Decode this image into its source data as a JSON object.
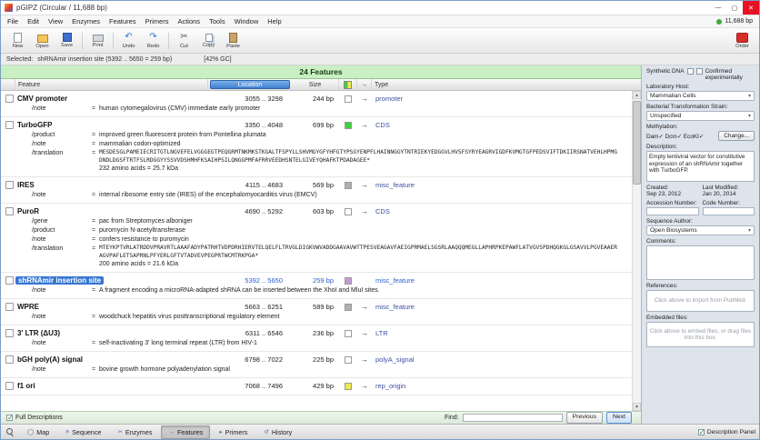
{
  "window": {
    "title": "pGIPZ  (Circular / 11,688 bp)",
    "bp_indicator": "11,688 bp"
  },
  "menu": {
    "items": [
      "File",
      "Edit",
      "View",
      "Enzymes",
      "Features",
      "Primers",
      "Actions",
      "Tools",
      "Window",
      "Help"
    ]
  },
  "toolbar": {
    "buttons": [
      {
        "label": "New",
        "icon": "new-document-icon"
      },
      {
        "label": "Open",
        "icon": "open-folder-icon"
      },
      {
        "label": "Save",
        "icon": "save-disk-icon"
      },
      {
        "label": "Print",
        "icon": "printer-icon"
      },
      {
        "label": "Undo",
        "icon": "undo-arrow-icon"
      },
      {
        "label": "Redo",
        "icon": "redo-arrow-icon"
      },
      {
        "label": "Cut",
        "icon": "cut-icon"
      },
      {
        "label": "Copy",
        "icon": "copy-icon"
      },
      {
        "label": "Paste",
        "icon": "paste-icon"
      }
    ],
    "order": {
      "label": "Order",
      "icon": "order-cart-icon"
    }
  },
  "selection_bar": {
    "label": "Selected:",
    "text": "shRNAmir insertion site  (5392 .. 5650 = 259 bp)",
    "gc": "[42% GC]"
  },
  "features_panel": {
    "header": "24 Features",
    "columns": {
      "feature": "Feature",
      "location": "Location",
      "size": "Size",
      "type": "Type"
    },
    "features": [
      {
        "name": "CMV promoter",
        "location": "3055 .. 3298",
        "size": "244 bp",
        "color": "#ffffff",
        "arrow": "→",
        "type": "promoter",
        "selected": false,
        "qualifiers": [
          {
            "key": "/note",
            "value": "human cytomegalovirus (CMV) immediate early promoter"
          }
        ]
      },
      {
        "name": "TurboGFP",
        "location": "3350 .. 4048",
        "size": "699 bp",
        "color": "#3ecf3e",
        "arrow": "→",
        "type": "CDS",
        "selected": false,
        "qualifiers": [
          {
            "key": "/product",
            "value": "improved green fluorescent protein from Pontellina plumata"
          },
          {
            "key": "/note",
            "value": "mammalian codon-optimized"
          },
          {
            "key": "/translation",
            "value": "MESDESGLPAMEIECRITGTLNGVEFELVGGGEGTPEQGRMTNKMKSTKGALTFSPYLLSHVMGYGFYHFGTYPSGYENPFLHAINNGGYTNTRIEKYEDGGVLHVSFSYRYEAGRVIGDFKVMGTGFPEDSVIFTDKIIRSNATVEHLHPMGDNDLDGSFTRTFSLRDGGYYSSVVDSHMHFKSAIHPSILQNGGPMFAFRRVEEDHSNTELGIVEYQHAFKTPDADAGEE*"
          }
        ],
        "footnote": "232 amino acids  =  25.7 kDa"
      },
      {
        "name": "IRES",
        "location": "4115 .. 4683",
        "size": "569 bp",
        "color": "#b0b0b0",
        "arrow": "→",
        "type": "misc_feature",
        "selected": false,
        "qualifiers": [
          {
            "key": "/note",
            "value": "internal ribosome entry site (IRES) of the encephalomyocarditis virus (EMCV)"
          }
        ]
      },
      {
        "name": "PuroR",
        "location": "4690 .. 5292",
        "size": "603 bp",
        "color": "#ffffff",
        "arrow": "→",
        "type": "CDS",
        "selected": false,
        "qualifiers": [
          {
            "key": "/gene",
            "value": "pac from Streptomyces alboniger"
          },
          {
            "key": "/product",
            "value": "puromycin N-acetyltransferase"
          },
          {
            "key": "/note",
            "value": "confers resistance to puromycin"
          },
          {
            "key": "/translation",
            "value": "MTEYKPTVRLATRDDVPRAVRTLAAAFADYPATRHTVDPDRHIERVTELQELFLTRVGLDIGKVWVADDGAAVAVWTTPESVEAGAVFAEIGPRMAELSGSRLAAQQQMEGLLAPHRPKEPAWFLATVGVSPDHQGKGLGSAVVLPGVEAAERAGVPAFLETSAPRNLPFYERLGFTVTADVEVPEGPRTWCMTRKPGA*"
          }
        ],
        "footnote": "200 amino acids  =  21.6 kDa"
      },
      {
        "name": "shRNAmir insertion site",
        "location": "5392 .. 5650",
        "size": "259 bp",
        "color": "#c39bd3",
        "arrow": "",
        "type": "misc_feature",
        "selected": true,
        "qualifiers": [
          {
            "key": "/note",
            "value": "A fragment encoding a microRNA-adapted shRNA can be inserted between the XhoI and MluI sites."
          }
        ]
      },
      {
        "name": "WPRE",
        "location": "5663 .. 6251",
        "size": "589 bp",
        "color": "#b0b0b0",
        "arrow": "→",
        "type": "misc_feature",
        "selected": false,
        "qualifiers": [
          {
            "key": "/note",
            "value": "woodchuck hepatitis virus posttranscriptional regulatory element"
          }
        ]
      },
      {
        "name": "3' LTR (ΔU3)",
        "location": "6311 .. 6546",
        "size": "236 bp",
        "color": "#ffffff",
        "arrow": "→",
        "type": "LTR",
        "selected": false,
        "qualifiers": [
          {
            "key": "/note",
            "value": "self-inactivating 3' long terminal repeat (LTR) from HIV-1"
          }
        ]
      },
      {
        "name": "bGH poly(A) signal",
        "location": "6798 .. 7022",
        "size": "225 bp",
        "color": "#ffffff",
        "arrow": "→",
        "type": "polyA_signal",
        "selected": false,
        "qualifiers": [
          {
            "key": "/note",
            "value": "bovine growth hormone polyadenylation signal"
          }
        ]
      },
      {
        "name": "f1 ori",
        "location": "7068 .. 7496",
        "size": "429 bp",
        "color": "#f2e94e",
        "arrow": "→",
        "type": "rep_origin",
        "selected": false,
        "qualifiers": []
      }
    ]
  },
  "sidebar": {
    "synthetic_dna": "Synthetic DNA",
    "confirmed": "Confirmed experimentally",
    "lab_host_label": "Laboratory Host:",
    "lab_host_value": "Mammalian Cells",
    "strain_label": "Bacterial Transformation Strain:",
    "strain_value": "Unspecified",
    "methylation_label": "Methylation:",
    "methylation_value": "Dam✓  Dcm✓  EcoKI✓",
    "change_button": "Change...",
    "description_label": "Description:",
    "description_text": "Empty lentiviral vector for constitutive expression of an shRNAmir together with TurboGFP.",
    "created_label": "Created:",
    "created_value": "Sep 23, 2012",
    "modified_label": "Last Modified:",
    "modified_value": "Jan 20, 2014",
    "accession_label": "Accession Number:",
    "code_label": "Code Number:",
    "author_label": "Sequence Author:",
    "author_value": "Open Biosystems",
    "comments_label": "Comments:",
    "references_label": "References:",
    "references_hint": "Click above to import from PubMed.",
    "embedded_label": "Embedded files:",
    "embedded_hint": "Click above to embed files, or drag files into this box."
  },
  "find_bar": {
    "full_descriptions": "Full Descriptions",
    "find_label": "Find:",
    "previous": "Previous",
    "next": "Next"
  },
  "tab_bar": {
    "tabs": [
      {
        "label": "Map",
        "icon": "map-tab-icon"
      },
      {
        "label": "Sequence",
        "icon": "sequence-tab-icon"
      },
      {
        "label": "Enzymes",
        "icon": "enzymes-tab-icon"
      },
      {
        "label": "Features",
        "icon": "features-tab-icon"
      },
      {
        "label": "Primers",
        "icon": "primers-tab-icon"
      },
      {
        "label": "History",
        "icon": "history-tab-icon"
      }
    ],
    "active": "Features",
    "description_panel": "Description Panel"
  },
  "colors": {
    "accent_blue": "#3f7fd0",
    "header_green": "#c9efc3",
    "selection_blue": "#3576d2",
    "type_link_blue": "#3c50a0",
    "order_red": "#d62f28"
  }
}
